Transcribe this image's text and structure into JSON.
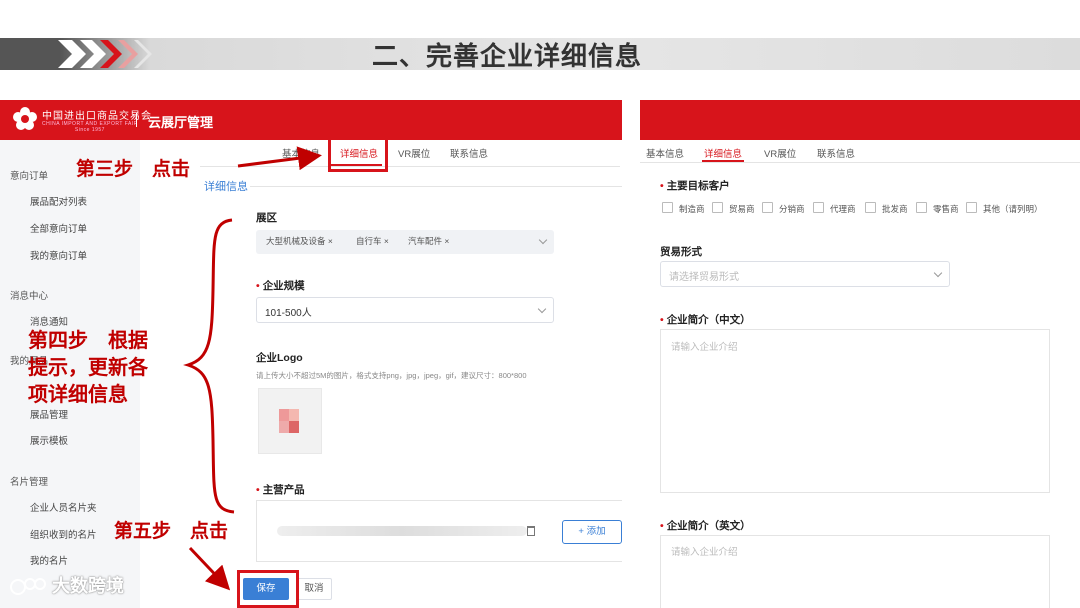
{
  "slide": {
    "title": "二、完善企业详细信息"
  },
  "left": {
    "logo_cn": "中国进出口商品交易会",
    "logo_en": "CHINA IMPORT AND EXPORT FAIR",
    "logo_since": "Since 1957",
    "app_title": "云展厅管理",
    "sidebar": {
      "groups": [
        "意向订单",
        "消息中心",
        "我的展品",
        "名片管理"
      ],
      "items": [
        "展品配对列表",
        "全部意向订单",
        "我的意向订单",
        "消息通知",
        "展品管理",
        "展示模板",
        "企业人员名片夹",
        "组织收到的名片",
        "我的名片"
      ]
    },
    "tabs": [
      "基本信息",
      "详细信息",
      "VR展位",
      "联系信息"
    ],
    "active_tab": "详细信息",
    "section_title": "详细信息",
    "fields": {
      "exhibit_area_label": "展区",
      "exhibit_area_chips": [
        "大型机械及设备",
        "自行车",
        "汽车配件"
      ],
      "scale_label": "企业规模",
      "scale_value": "101-500人",
      "logo_label": "企业Logo",
      "logo_hint": "请上传大小不超过5M的图片，格式支持png，jpg，jpeg，gif，建议尺寸：800*800",
      "main_product_label": "主营产品",
      "add_button": "+ 添加"
    },
    "save_button": "保存",
    "cancel_button": "取消"
  },
  "right": {
    "tabs": [
      "基本信息",
      "详细信息",
      "VR展位",
      "联系信息"
    ],
    "active_tab": "详细信息",
    "target_customers_label": "主要目标客户",
    "target_customers": [
      "制造商",
      "贸易商",
      "分销商",
      "代理商",
      "批发商",
      "零售商",
      "其他（请列明）"
    ],
    "trade_form_label": "贸易形式",
    "trade_form_placeholder": "请选择贸易形式",
    "intro_cn_label": "企业简介（中文）",
    "intro_cn_placeholder": "请输入企业介绍",
    "intro_en_label": "企业简介（英文）",
    "intro_en_placeholder": "请输入企业介绍"
  },
  "annotations": {
    "step3": "第三步　点击",
    "step4_line1": "第四步　根据",
    "step4_line2": "提示，更新各",
    "step4_line3": "项详细信息",
    "step5": "第五步　点击"
  },
  "watermark": "大数跨境",
  "colors": {
    "brand_red": "#d7141b",
    "annotation_red": "#c00000",
    "primary_blue": "#3a7fd5"
  }
}
